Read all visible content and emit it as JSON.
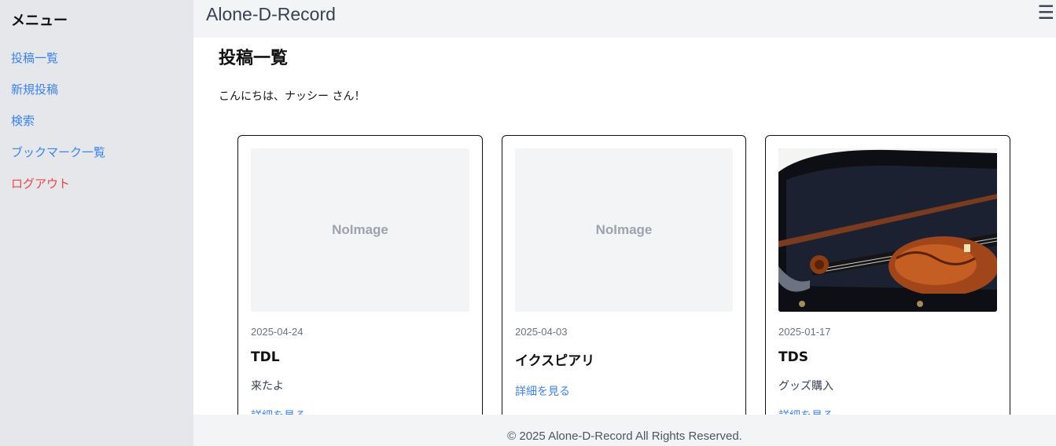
{
  "sidebar": {
    "title": "メニュー",
    "items": [
      {
        "label": "投稿一覧"
      },
      {
        "label": "新規投稿"
      },
      {
        "label": "検索"
      },
      {
        "label": "ブックマーク一覧"
      },
      {
        "label": "ログアウト"
      }
    ]
  },
  "header": {
    "app_title": "Alone-D-Record",
    "menu_icon": "hamburger-icon",
    "menu_glyph": "☰"
  },
  "main": {
    "page_title": "投稿一覧",
    "greeting": "こんにちは、ナッシー さん！",
    "cards": [
      {
        "image_text": "NoImage",
        "date": "2025-04-24",
        "title": "TDL",
        "body": "来たよ",
        "link": "詳細を見る"
      },
      {
        "image_text": "NoImage",
        "date": "2025-04-03",
        "title": "イクスピアリ",
        "body": "",
        "link": "詳細を見る"
      },
      {
        "image_text": "",
        "image": "violin-in-case-photo",
        "date": "2025-01-17",
        "title": "TDS",
        "body": "グッズ購入",
        "link": "詳細を見る"
      }
    ]
  },
  "footer": {
    "text": "© 2025 Alone-D-Record All Rights Reserved."
  },
  "colors": {
    "link": "#3b82f6",
    "logout": "#ef4444",
    "sidebar_bg": "#e5e7eb",
    "header_bg": "#f3f4f6"
  }
}
